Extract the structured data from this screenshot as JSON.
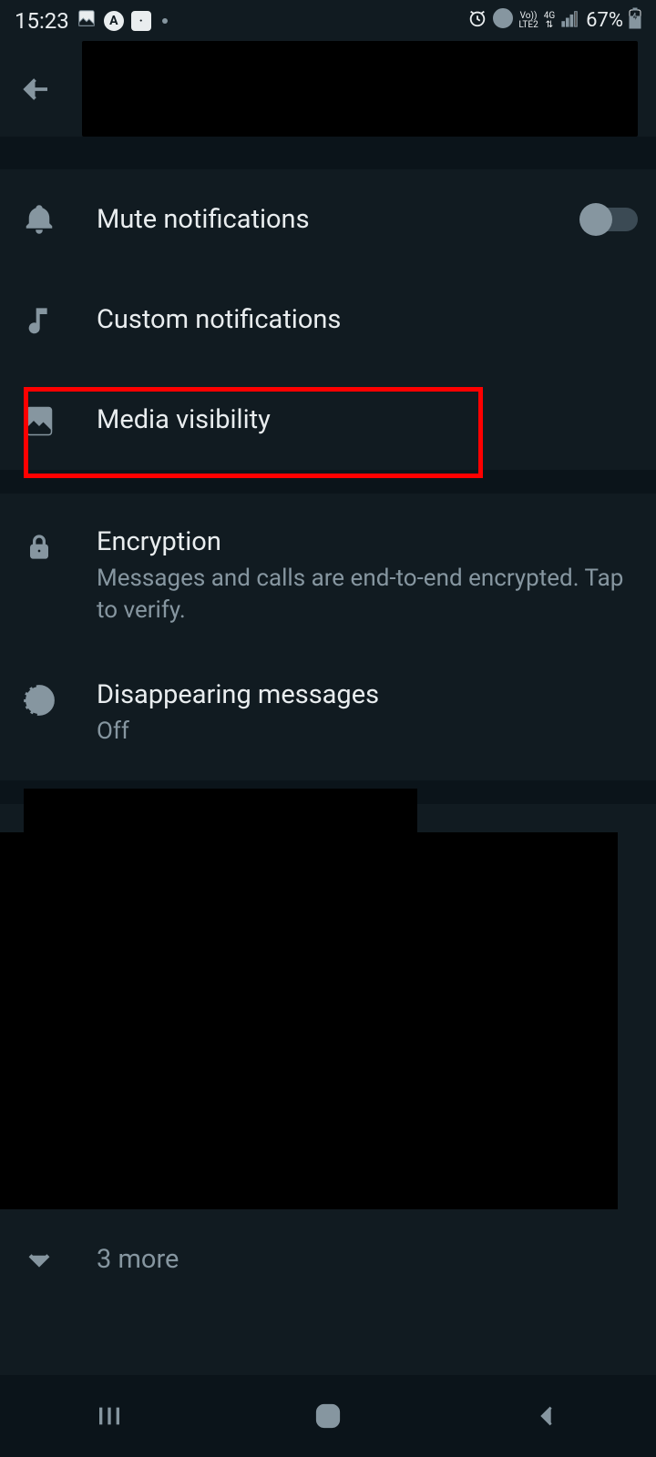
{
  "status": {
    "time": "15:23",
    "battery": "67%",
    "net": "4G",
    "lte": "LTE2",
    "vo": "Vo))"
  },
  "rows": {
    "mute": {
      "title": "Mute notifications"
    },
    "custom": {
      "title": "Custom notifications"
    },
    "media": {
      "title": "Media visibility"
    },
    "enc": {
      "title": "Encryption",
      "sub": "Messages and calls are end-to-end encrypted. Tap to verify."
    },
    "disap": {
      "title": "Disappearing messages",
      "sub": "Off"
    },
    "more": {
      "title": "3 more"
    }
  }
}
